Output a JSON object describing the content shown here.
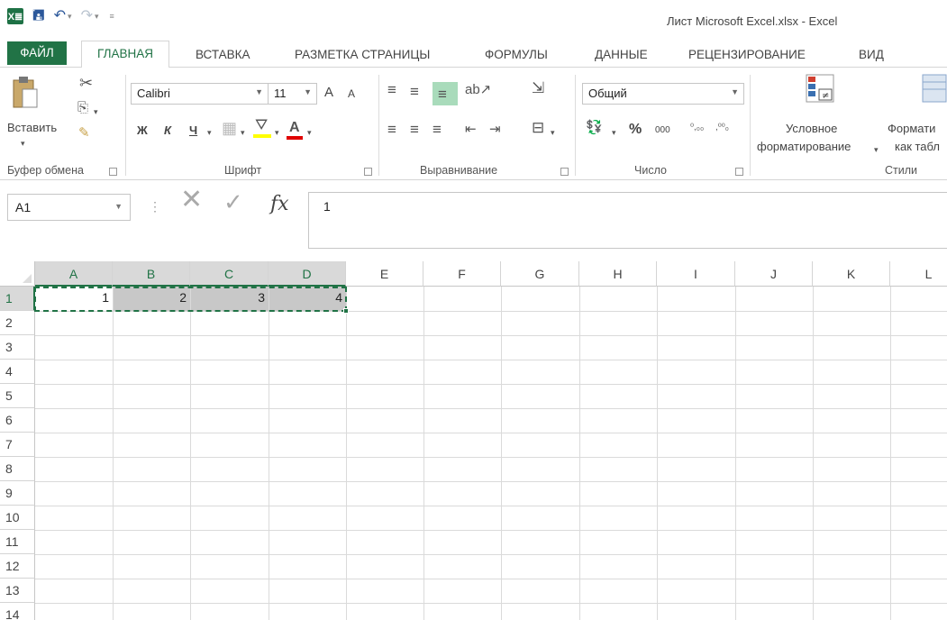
{
  "window": {
    "title": "Лист Microsoft Excel.xlsx - Excel",
    "app_icon": "X≣"
  },
  "ribbon_tabs": [
    "ФАЙЛ",
    "ГЛАВНАЯ",
    "ВСТАВКА",
    "РАЗМЕТКА СТРАНИЦЫ",
    "ФОРМУЛЫ",
    "ДАННЫЕ",
    "РЕЦЕНЗИРОВАНИЕ",
    "ВИД"
  ],
  "active_tab": "ГЛАВНАЯ",
  "clipboard": {
    "paste_label": "Вставить",
    "group_label": "Буфер обмена"
  },
  "font": {
    "name": "Calibri",
    "size": "11",
    "bold": "Ж",
    "italic": "К",
    "underline": "Ч",
    "grow": "A",
    "shrink": "A",
    "font_color_glyph": "A",
    "group_label": "Шрифт"
  },
  "alignment": {
    "group_label": "Выравнивание"
  },
  "number": {
    "format": "Общий",
    "percent": "%",
    "thousands": "000",
    "group_label": "Число"
  },
  "styles": {
    "conditional_line1": "Условное",
    "conditional_line2": "форматирование",
    "format_table_line1": "Формати",
    "format_table_line2": "как табл",
    "group_label": "Стили"
  },
  "formula_bar": {
    "name_box": "A1",
    "content": "1",
    "fx": "fx"
  },
  "sheet": {
    "columns": [
      "A",
      "B",
      "C",
      "D",
      "E",
      "F",
      "G",
      "H",
      "I",
      "J",
      "K",
      "L"
    ],
    "rows": [
      "1",
      "2",
      "3",
      "4",
      "5",
      "6",
      "7",
      "8",
      "9",
      "10",
      "11",
      "12",
      "13",
      "14"
    ],
    "row1_values": [
      "1",
      "2",
      "3",
      "4"
    ]
  },
  "colors": {
    "accent": "#217346",
    "selection_shade": "#c8c8c8",
    "header_selected": "#d9d9d9"
  }
}
